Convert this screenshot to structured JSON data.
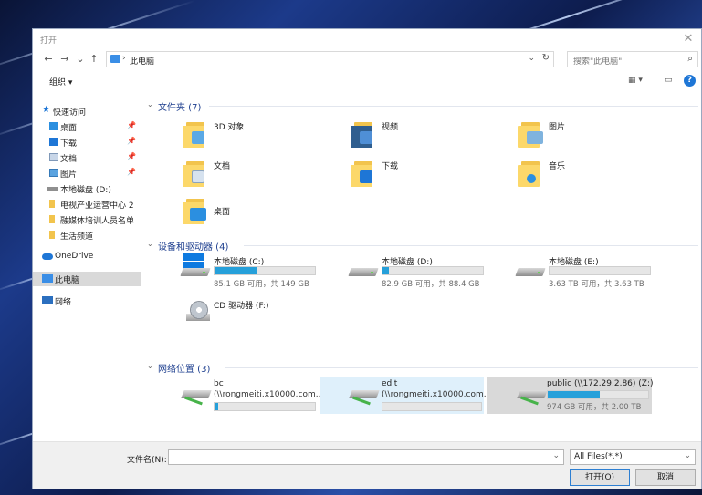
{
  "window": {
    "title": "打开",
    "close_glyph": "✕"
  },
  "nav": {
    "back": "←",
    "forward": "→",
    "recent": "⌄",
    "up": "↑"
  },
  "address": {
    "separator": "›",
    "path": "此电脑",
    "dropdown": "⌄",
    "refresh": "↻"
  },
  "search": {
    "placeholder": "搜索\"此电脑\"",
    "icon": "⌕"
  },
  "toolbar": {
    "organize": "组织 ▾",
    "view_options": "▦ ▾",
    "pane": "▭",
    "help": "?"
  },
  "sidebar": {
    "items": [
      {
        "label": "快速访问",
        "pin": ""
      },
      {
        "label": "桌面",
        "pin": "📌"
      },
      {
        "label": "下载",
        "pin": "📌"
      },
      {
        "label": "文档",
        "pin": "📌"
      },
      {
        "label": "图片",
        "pin": "📌"
      },
      {
        "label": "本地磁盘 (D:)",
        "pin": ""
      },
      {
        "label": "电视产业运营中心 2",
        "pin": ""
      },
      {
        "label": "融媒体培训人员名单",
        "pin": ""
      },
      {
        "label": "生活频道",
        "pin": ""
      },
      {
        "label": "OneDrive",
        "pin": ""
      },
      {
        "label": "此电脑",
        "pin": ""
      },
      {
        "label": "网络",
        "pin": ""
      }
    ]
  },
  "groups": {
    "folders": {
      "title": "文件夹 (7)",
      "chevron": "⌄"
    },
    "drives": {
      "title": "设备和驱动器 (4)",
      "chevron": "⌄"
    },
    "network": {
      "title": "网络位置 (3)",
      "chevron": "⌄"
    }
  },
  "folders": [
    {
      "name": "3D 对象"
    },
    {
      "name": "视频"
    },
    {
      "name": "图片"
    },
    {
      "name": "文档"
    },
    {
      "name": "下载"
    },
    {
      "name": "音乐"
    },
    {
      "name": "桌面"
    }
  ],
  "drives": [
    {
      "name": "本地磁盘 (C:)",
      "info": "85.1 GB 可用，共 149 GB",
      "used_fraction": 0.43
    },
    {
      "name": "本地磁盘 (D:)",
      "info": "82.9 GB 可用，共 88.4 GB",
      "used_fraction": 0.06
    },
    {
      "name": "本地磁盘 (E:)",
      "info": "3.63 TB 可用，共 3.63 TB",
      "used_fraction": 0.0
    },
    {
      "name": "CD 驱动器 (F:)"
    }
  ],
  "network_locations": [
    {
      "name": "bc",
      "path": "(\\\\rongmeiti.x10000.com...",
      "used_fraction": 0.04
    },
    {
      "name": "edit",
      "path": "(\\\\rongmeiti.x10000.com...",
      "used_fraction": 0.0
    },
    {
      "name": "public (\\\\172.29.2.86) (Z:)",
      "info": "974 GB 可用，共 2.00 TB",
      "used_fraction": 0.52
    }
  ],
  "footer": {
    "filename_label": "文件名(N):",
    "filename_value": "",
    "filter": "All Files(*.*)",
    "dropdown": "⌄",
    "open": "打开(O)",
    "cancel": "取消"
  },
  "colors": {
    "accent": "#26a0da",
    "group_title": "#1e3f8f",
    "folder": "#fcd86a",
    "selected_tile": "#dff0fb"
  }
}
